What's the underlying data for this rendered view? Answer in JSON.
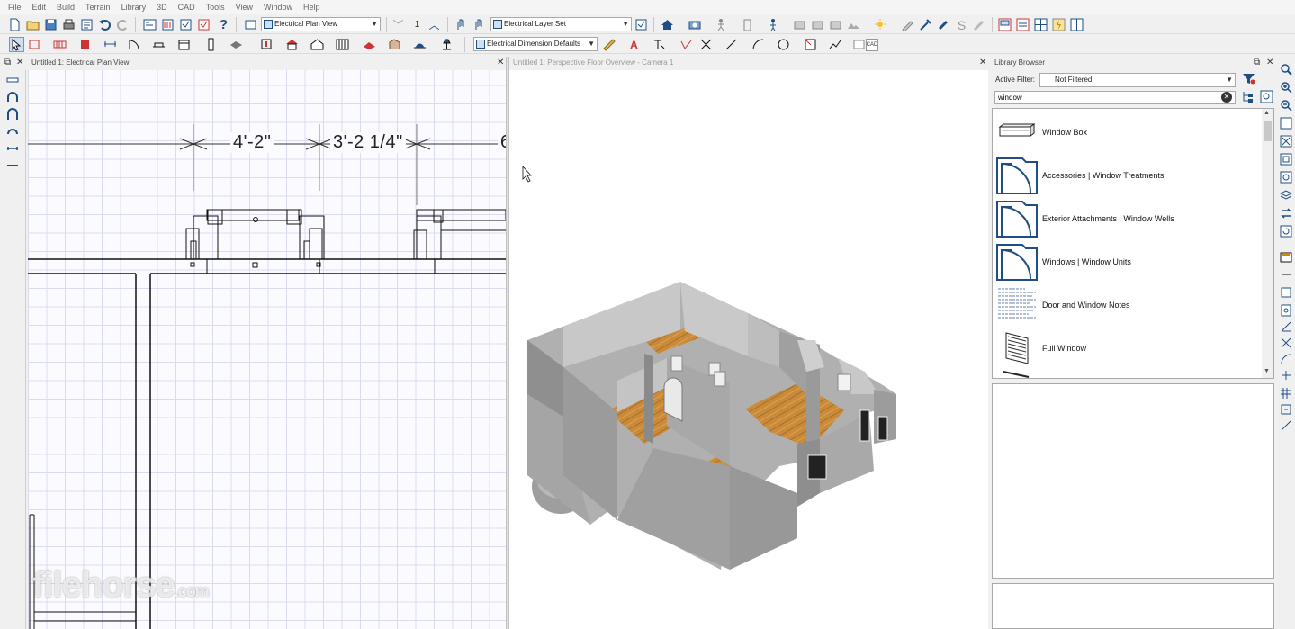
{
  "menu": [
    "File",
    "Edit",
    "Build",
    "Terrain",
    "Library",
    "3D",
    "CAD",
    "Tools",
    "View",
    "Window",
    "Help"
  ],
  "toolbar1": {
    "plan_view": "Electrical Plan View",
    "floor": "1",
    "layer_set": "Electrical Layer Set"
  },
  "toolbar2": {
    "dimension_defaults": "Electrical Dimension Defaults"
  },
  "plan_panel": {
    "title": "Untitled 1: Electrical Plan View",
    "dim1": "4'-2\"",
    "dim2": "3'-2 1/4\"",
    "dim3": "6"
  },
  "view3d_panel": {
    "title": "Untitled 1: Perspective Floor Overview - Camera 1"
  },
  "library": {
    "title": "Library Browser",
    "filter_label": "Active Filter:",
    "filter_value": "Not Filtered",
    "search_value": "window",
    "items": [
      {
        "label": "Window Box",
        "icon": "window-box-icon"
      },
      {
        "label": "Accessories | Window Treatments",
        "icon": "folder-icon"
      },
      {
        "label": "Exterior Attachments | Window Wells",
        "icon": "folder-icon"
      },
      {
        "label": "Windows | Window Units",
        "icon": "folder-icon"
      },
      {
        "label": "Door and Window Notes",
        "icon": "notes-icon"
      },
      {
        "label": "Full Window",
        "icon": "full-window-icon"
      }
    ]
  },
  "watermark": {
    "text": "filehorse",
    "suffix": ".com"
  }
}
